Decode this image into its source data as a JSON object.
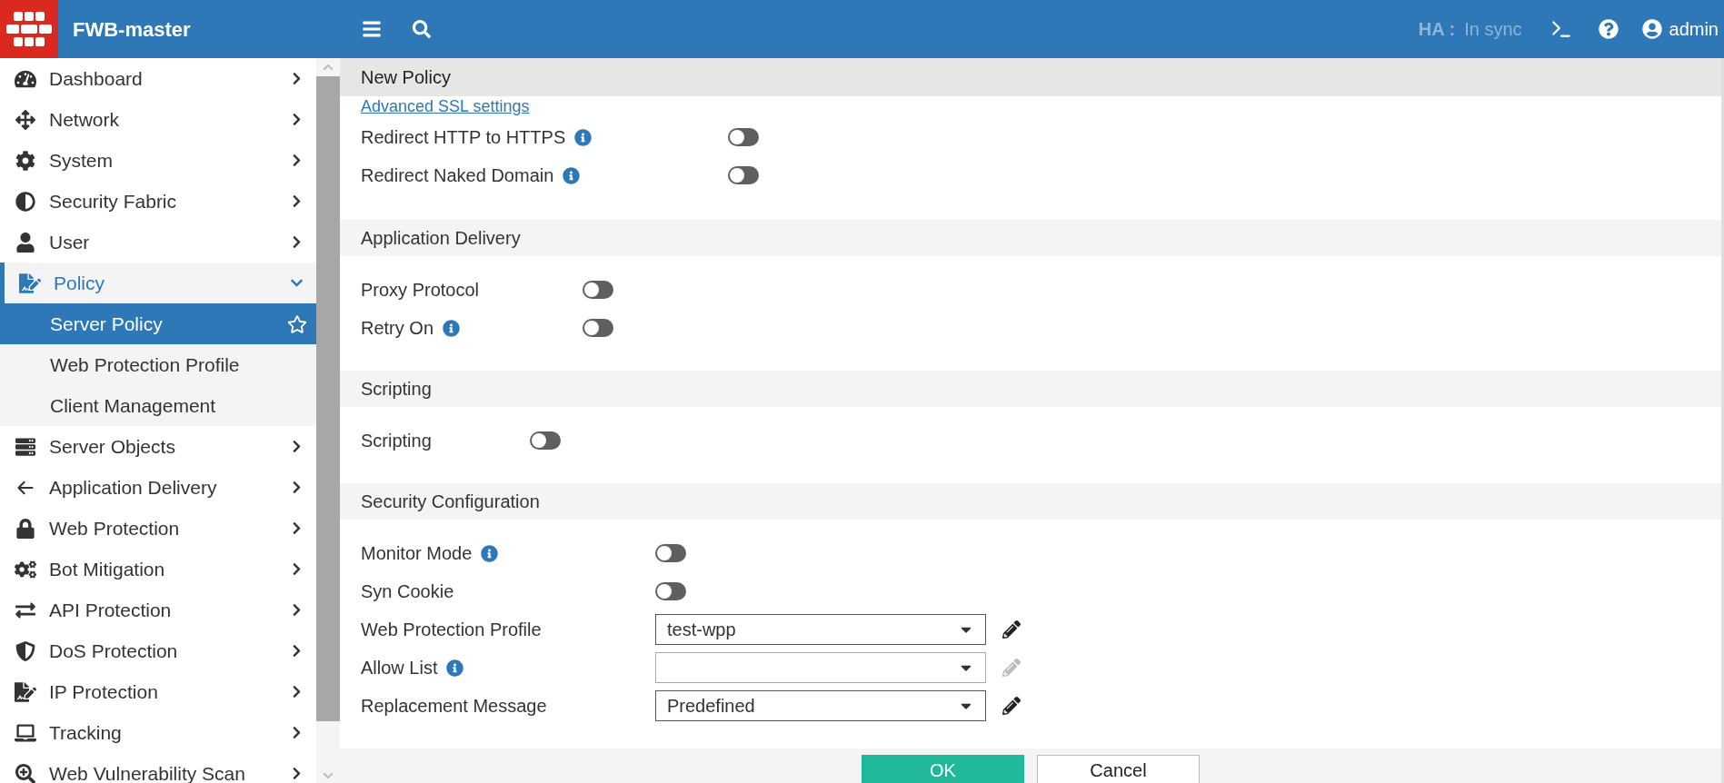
{
  "header": {
    "title": "FWB-master",
    "ha_label": "HA :",
    "ha_status": "In sync",
    "user": "admin"
  },
  "sidebar": {
    "items": [
      {
        "label": "Dashboard",
        "expanded": false
      },
      {
        "label": "Network",
        "expanded": false
      },
      {
        "label": "System",
        "expanded": false
      },
      {
        "label": "Security Fabric",
        "expanded": false
      },
      {
        "label": "User",
        "expanded": false
      },
      {
        "label": "Policy",
        "expanded": true,
        "children": [
          {
            "label": "Server Policy",
            "selected": true
          },
          {
            "label": "Web Protection Profile",
            "selected": false
          },
          {
            "label": "Client Management",
            "selected": false
          }
        ]
      },
      {
        "label": "Server Objects",
        "expanded": false
      },
      {
        "label": "Application Delivery",
        "expanded": false
      },
      {
        "label": "Web Protection",
        "expanded": false
      },
      {
        "label": "Bot Mitigation",
        "expanded": false
      },
      {
        "label": "API Protection",
        "expanded": false
      },
      {
        "label": "DoS Protection",
        "expanded": false
      },
      {
        "label": "IP Protection",
        "expanded": false
      },
      {
        "label": "Tracking",
        "expanded": false
      },
      {
        "label": "Web Vulnerability Scan",
        "expanded": false
      }
    ]
  },
  "page": {
    "title": "New Policy",
    "link": "Advanced SSL settings",
    "sections": [
      {
        "rows": [
          {
            "kind": "toggle",
            "label": "Redirect HTTP to HTTPS",
            "info": true,
            "on": false
          },
          {
            "kind": "toggle",
            "label": "Redirect Naked Domain",
            "info": true,
            "on": false
          }
        ]
      },
      {
        "title": "Application Delivery",
        "rows": [
          {
            "kind": "toggle",
            "label": "Proxy Protocol",
            "info": false,
            "on": false
          },
          {
            "kind": "toggle",
            "label": "Retry On",
            "info": true,
            "on": false
          }
        ]
      },
      {
        "title": "Scripting",
        "rows": [
          {
            "kind": "toggle",
            "label": "Scripting",
            "info": false,
            "on": false
          }
        ]
      },
      {
        "title": "Security Configuration",
        "rows": [
          {
            "kind": "toggle",
            "label": "Monitor Mode",
            "info": true,
            "on": false
          },
          {
            "kind": "toggle",
            "label": "Syn Cookie",
            "info": false,
            "on": false
          },
          {
            "kind": "select",
            "label": "Web Protection Profile",
            "info": false,
            "value": "test-wpp",
            "editable": true
          },
          {
            "kind": "select",
            "label": "Allow List",
            "info": true,
            "value": "",
            "editable": false
          },
          {
            "kind": "select",
            "label": "Replacement Message",
            "info": false,
            "value": "Predefined",
            "editable": true
          }
        ]
      }
    ]
  },
  "footer": {
    "buttons": [
      {
        "label": "OK",
        "kind": "primary"
      },
      {
        "label": "Cancel",
        "kind": "secondary"
      }
    ]
  }
}
